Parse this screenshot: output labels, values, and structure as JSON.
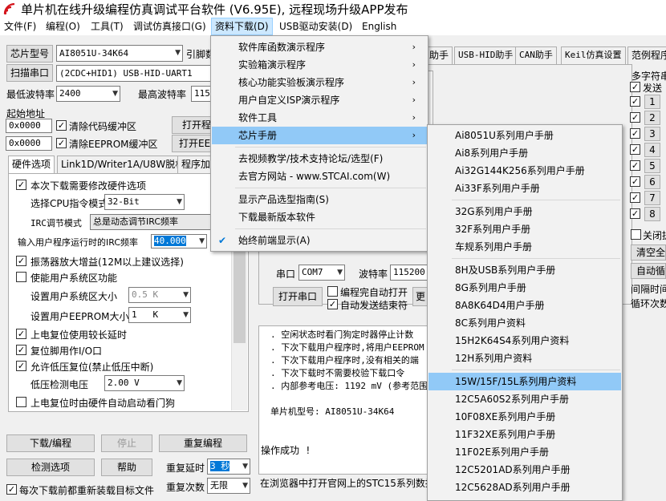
{
  "window": {
    "title": "单片机在线升级编程仿真调试平台软件 (V6.95E), 远程现场升级APP发布"
  },
  "menubar": [
    {
      "label": "文件(F)"
    },
    {
      "label": "编程(O)"
    },
    {
      "label": "工具(T)"
    },
    {
      "label": "调试仿真接口(G)"
    },
    {
      "label": "资料下载(D)"
    },
    {
      "label": "USB驱动安装(D)"
    },
    {
      "label": "English"
    }
  ],
  "left": {
    "chip_model_btn": "芯片型号",
    "chip_model_value": "AI8051U-34K64",
    "chip_model_extra": "引脚数",
    "scan_port_btn": "扫描串口",
    "scan_port_value": "(2CDC+HID1) USB-HID-UART1",
    "min_baud_label": "最低波特率",
    "min_baud_value": "2400",
    "max_baud_label": "最高波特率",
    "max_baud_value": "1152",
    "start_addr_label": "起始地址",
    "code_addr": "0x0000",
    "clear_code": "清除代码缓冲区",
    "open_prog": "打开程",
    "eeprom_addr": "0x0000",
    "clear_eeprom": "清除EEPROM缓冲区",
    "open_eeprom": "打开EEI",
    "tabs": [
      "硬件选项",
      "Link1D/Writer1A/U8W脱机",
      "程序加"
    ],
    "options": {
      "reconfig": "本次下载需要修改硬件选项",
      "cpu_mode_label": "选择CPU指令模式",
      "cpu_mode_value": "32-Bit",
      "irc_mode_label": "IRC调节模式",
      "irc_mode_value": "总是动态调节IRC频率",
      "irc_freq_label": "输入用户程序运行时的IRC频率",
      "irc_freq_value": "40.000",
      "osc_gain": "振荡器放大增益(12M以上建议选择)",
      "sys_area": "使能用户系统区功能",
      "sys_size_label": "设置用户系统区大小",
      "sys_size_value": "0.5 K",
      "eeprom_size_label": "设置用户EEPROM大小",
      "eeprom_size_value": "1   K",
      "power_delay": "上电复位使用较长延时",
      "reset_io": "复位脚用作I/O口",
      "lvr": "允许低压复位(禁止低压中断)",
      "lv_detect_label": "低压检测电压",
      "lv_detect_value": "2.00 V",
      "wdt": "上电复位时由硬件自动启动看门狗"
    },
    "download_btn": "下载/编程",
    "stop_btn": "停止",
    "reprog_btn": "重复编程",
    "check_btn": "检测选项",
    "help_btn": "帮助",
    "repeat_delay_label": "重复延时",
    "repeat_delay_value": "3 秒",
    "repeat_count_label": "重复次数",
    "repeat_count_value": "无限",
    "reload_check": "每次下载前都重新装载目标文件"
  },
  "right": {
    "tabs": [
      "USB-HID助手",
      "CAN助手",
      "Keil仿真设置",
      "范例程序"
    ],
    "partial_tab": "助手",
    "multi_str": "多字符串",
    "send_label": "发送",
    "rows": [
      "1",
      "2",
      "3",
      "4",
      "5",
      "6",
      "7",
      "8"
    ],
    "close_label": "关闭提",
    "clear_all": "清空全",
    "auto_loop": "自动循",
    "interval": "间隔时间",
    "loop_count": "循环次数",
    "port_label": "串口",
    "port_value": "COM7",
    "baud_label": "波特率",
    "baud_value": "115200",
    "open_port": "打开串口",
    "auto_open": "编程完自动打开",
    "auto_send": "自动发送结束符",
    "partial_btn": "更",
    "log_lines": [
      ". 空闲状态时看门狗定时器停止计数",
      ". 下次下载用户程序时,将用户EEPROM",
      ". 下次下载用户程序时,没有相关的端",
      ". 下次下载时不需要校验下载口令",
      ". 内部参考电压: 1192 mV (参考范围"
    ],
    "chip_line": "单片机型号: AI8051U-34K64",
    "success": "操作成功 !",
    "status": "在浏览器中打开官网上的STC15系列数据"
  },
  "dropdown": {
    "items": [
      {
        "label": "软件库函数演示程序",
        "arrow": "›"
      },
      {
        "label": "实验箱演示程序",
        "arrow": "›"
      },
      {
        "label": "核心功能实验板演示程序",
        "arrow": "›"
      },
      {
        "label": "用户自定义ISP演示程序",
        "arrow": "›"
      },
      {
        "label": "软件工具",
        "arrow": "›"
      },
      {
        "label": "芯片手册",
        "arrow": "›"
      },
      {
        "label": "去视频教学/技术支持论坛/选型(F)",
        "arrow": ""
      },
      {
        "label": "去官方网站 - www.STCAI.com(W)",
        "arrow": ""
      },
      {
        "label": "显示产品选型指南(S)",
        "arrow": ""
      },
      {
        "label": "下载最新版本软件",
        "arrow": ""
      },
      {
        "label": "始终前端显示(A)",
        "arrow": ""
      }
    ],
    "check_mark": "✔"
  },
  "submenu": {
    "items": [
      "Ai8051U系列用户手册",
      "Ai8系列用户手册",
      "Ai32G144K256系列用户手册",
      "Ai33F系列用户手册",
      "32G系列用户手册",
      "32F系列用户手册",
      "车规系列用户手册",
      "8H及USB系列用户手册",
      "8G系列用户手册",
      "8A8K64D4用户手册",
      "8C系列用户资料",
      "15H2K64S4系列用户资料",
      "12H系列用户资料",
      "15W/15F/15L系列用户资料",
      "12C5A60S2系列用户手册",
      "10F08XE系列用户手册",
      "11F32XE系列用户手册",
      "11F02E系列用户手册",
      "12C5201AD系列用户手册",
      "12C5628AD系列用户手册"
    ]
  },
  "colors": {
    "highlight": "#91c9f7",
    "accent_red": "#d4141c",
    "selection": "#0078d7"
  }
}
